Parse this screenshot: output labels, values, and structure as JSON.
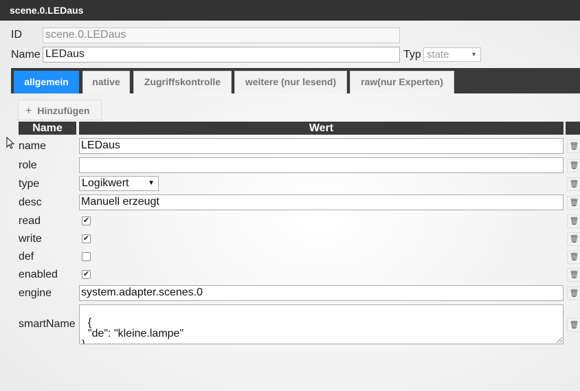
{
  "window": {
    "title": "scene.0.LEDaus"
  },
  "header": {
    "id_label": "ID",
    "id_value": "scene.0.LEDaus",
    "name_label": "Name",
    "name_value": "LEDaus",
    "typ_label": "Typ",
    "typ_value": "state"
  },
  "tabs": [
    {
      "label": "allgemein",
      "active": true
    },
    {
      "label": "native",
      "active": false
    },
    {
      "label": "Zugriffskontrolle",
      "active": false
    },
    {
      "label": "weitere (nur lesend)",
      "active": false
    },
    {
      "label": "raw(nur Experten)",
      "active": false
    }
  ],
  "toolbar": {
    "add_label": "Hinzufügen",
    "add_icon": "plus-icon"
  },
  "table": {
    "col_name": "Name",
    "col_value": "Wert",
    "rows": [
      {
        "name": "name",
        "kind": "text",
        "value": "LEDaus"
      },
      {
        "name": "role",
        "kind": "text",
        "value": ""
      },
      {
        "name": "type",
        "kind": "select",
        "value": "Logikwert"
      },
      {
        "name": "desc",
        "kind": "text",
        "value": "Manuell erzeugt"
      },
      {
        "name": "read",
        "kind": "checkbox",
        "checked": true
      },
      {
        "name": "write",
        "kind": "checkbox",
        "checked": true
      },
      {
        "name": "def",
        "kind": "checkbox",
        "checked": false
      },
      {
        "name": "enabled",
        "kind": "checkbox",
        "checked": true
      },
      {
        "name": "engine",
        "kind": "text",
        "value": "system.adapter.scenes.0"
      },
      {
        "name": "smartName",
        "kind": "textarea",
        "value": "{\n  \"de\": \"kleine.lampe\"\n}"
      }
    ],
    "delete_icon": "trash-icon"
  },
  "colors": {
    "tab_active": "#1e90ff",
    "header_bar": "#333333"
  }
}
